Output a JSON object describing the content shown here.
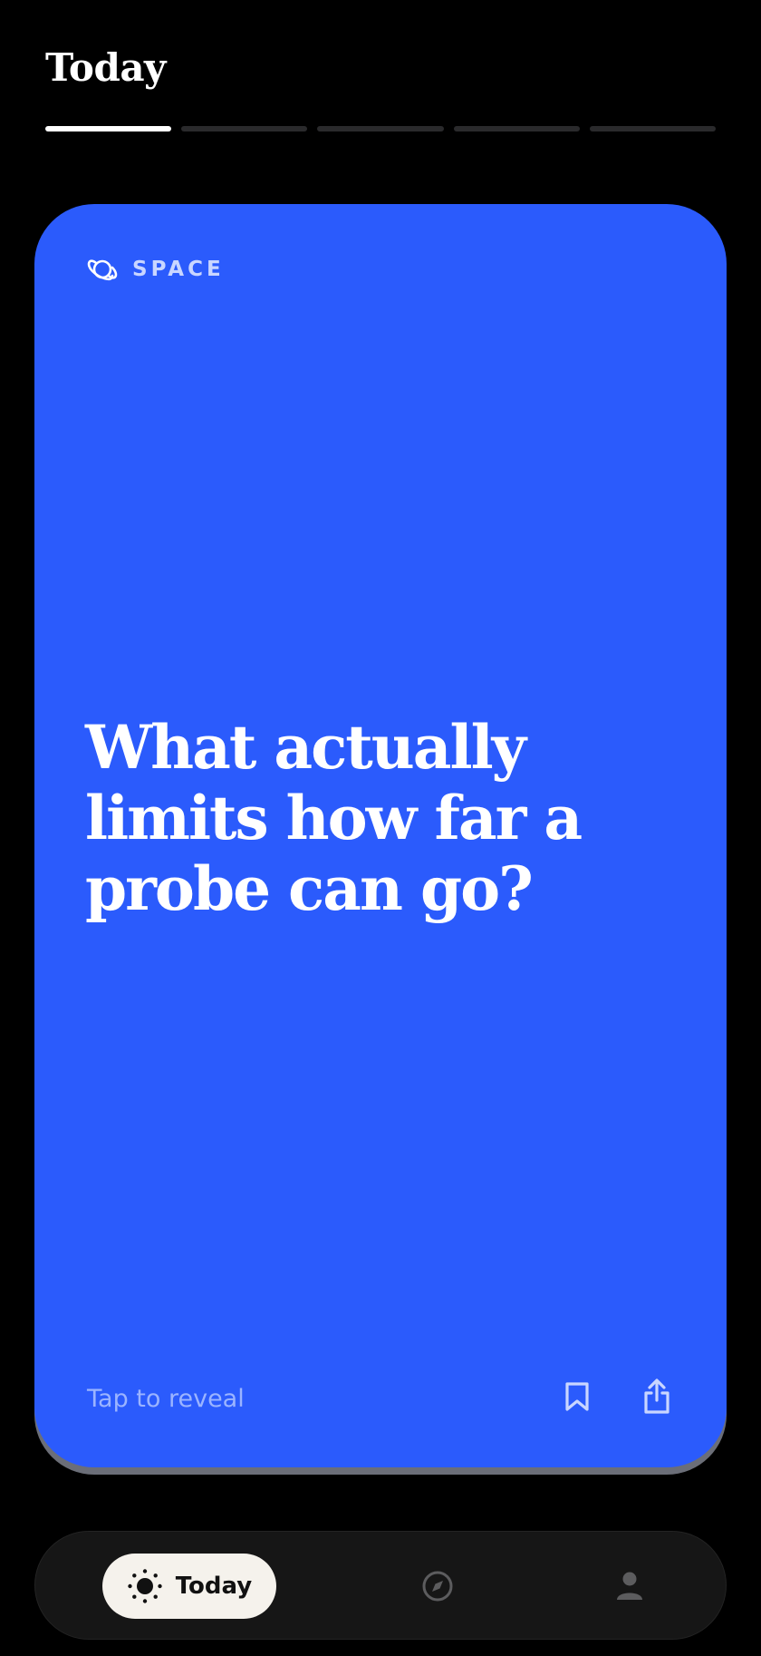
{
  "header": {
    "title": "Today"
  },
  "progress": {
    "total": 5,
    "current": 1
  },
  "card": {
    "category": "SPACE",
    "category_icon": "planet-icon",
    "question": "What actually limits how far a probe can go?",
    "reveal_label": "Tap to reveal",
    "bookmark_icon": "bookmark-icon",
    "share_icon": "share-icon",
    "background": "#2b5bfc"
  },
  "nav": {
    "today_label": "Today",
    "today_icon": "sun-icon",
    "explore_icon": "compass-icon",
    "profile_icon": "person-icon"
  }
}
